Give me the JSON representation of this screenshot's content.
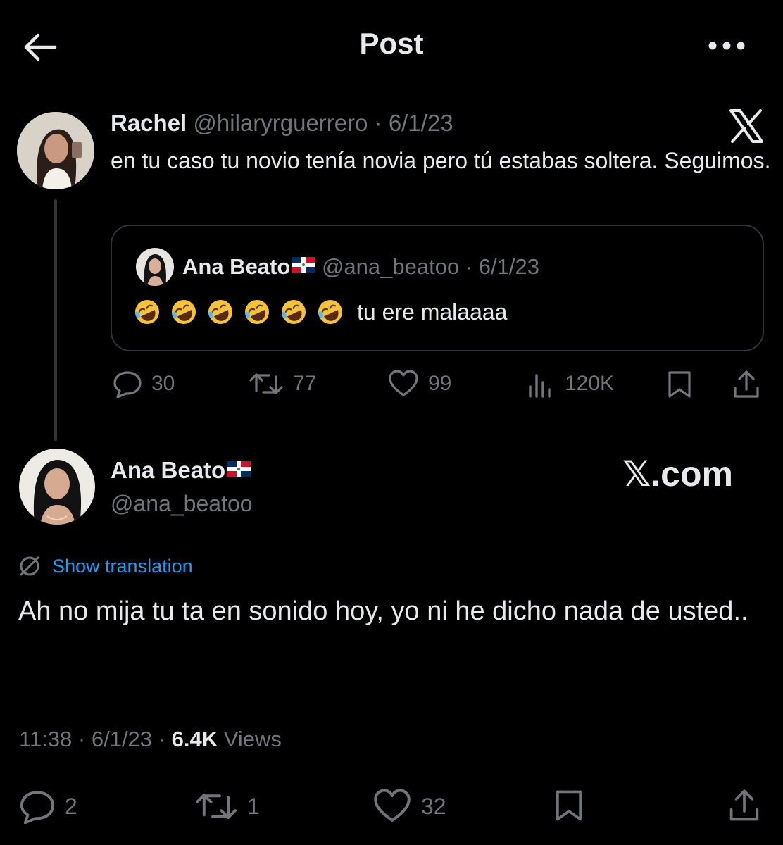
{
  "header": {
    "title": "Post"
  },
  "parent_tweet": {
    "name": "Rachel",
    "handle": "@hilaryrguerrero",
    "separator": " · ",
    "date": "6/1/23",
    "text": "en tu caso tu novio tenía novia pero tú estabas soltera. Seguimos.",
    "quote": {
      "name": "Ana Beato",
      "handle": "@ana_beatoo",
      "separator": " · ",
      "date": "6/1/23",
      "text": "tu ere malaaaa",
      "emoji_count": 6
    },
    "stats": {
      "replies": "30",
      "reposts": "77",
      "likes": "99",
      "views": "120K"
    }
  },
  "main_tweet": {
    "name": "Ana Beato",
    "handle": "@ana_beatoo",
    "watermark": "𝕏.com",
    "translation_label": "Show translation",
    "text": "Ah no mija tu ta en sonido hoy, yo ni he dicho nada de usted..",
    "time": "11:38",
    "separator": " · ",
    "date": "6/1/23",
    "views_count": "6.4K",
    "views_label": " Views",
    "stats": {
      "replies": "2",
      "reposts": "1",
      "likes": "32"
    }
  },
  "colors": {
    "background": "#000000",
    "text": "#e7e9ea",
    "muted": "#71767b",
    "link": "#1d9bf0",
    "border": "#2f3336"
  },
  "icons": [
    "back-arrow-icon",
    "more-icon",
    "x-logo-icon",
    "reply-icon",
    "repost-icon",
    "like-icon",
    "views-icon",
    "bookmark-icon",
    "share-icon",
    "translate-icon",
    "flag-dominican-republic-icon",
    "rolling-laughing-emoji"
  ]
}
